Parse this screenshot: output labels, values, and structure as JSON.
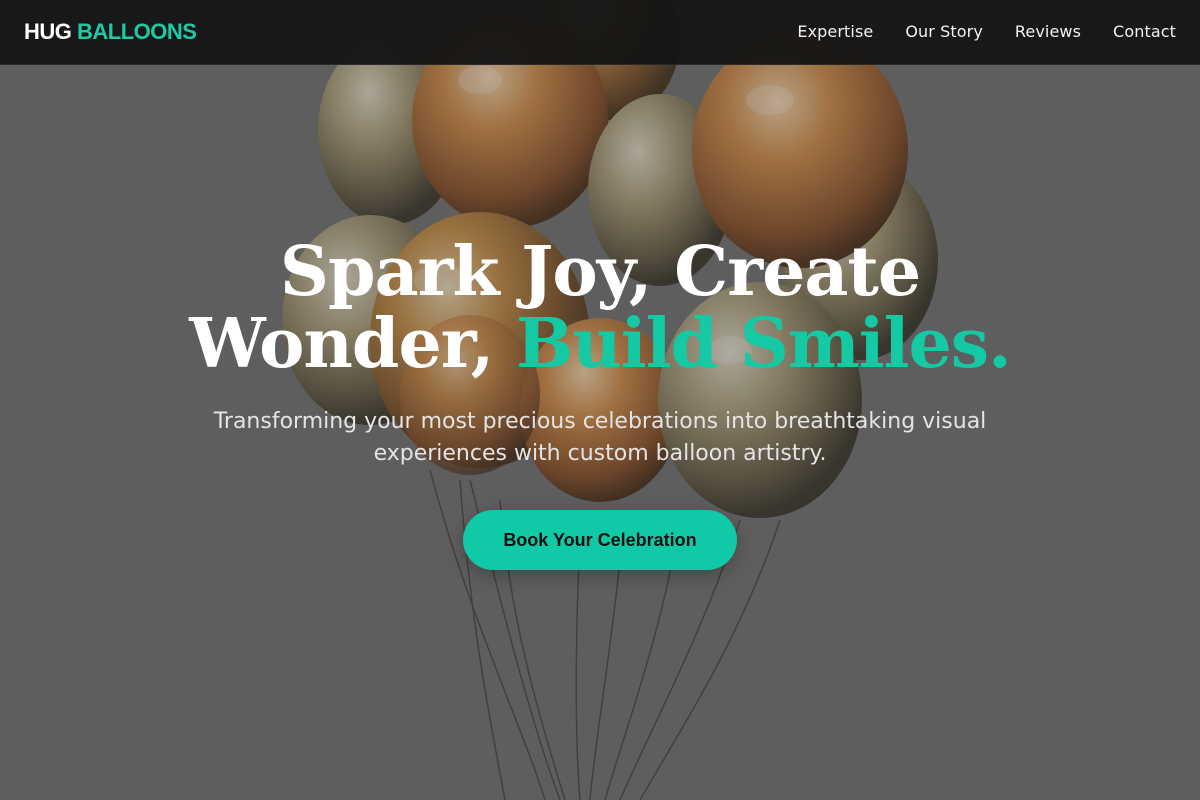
{
  "brand": {
    "name_part1": "HUG",
    "name_part2": "BALLOONS"
  },
  "nav": {
    "links": [
      {
        "label": "Expertise"
      },
      {
        "label": "Our Story"
      },
      {
        "label": "Reviews"
      },
      {
        "label": "Contact"
      }
    ]
  },
  "hero": {
    "headline_line1": "Spark Joy, Create",
    "headline_line2_start": "Wonder, ",
    "headline_line2_highlight": "Build Smiles.",
    "subtitle": "Transforming your most precious celebrations into breathtaking visual experiences with custom balloon artistry.",
    "cta_label": "Book Your Celebration",
    "background": "balloon-bouquet-image"
  },
  "colors": {
    "accent": "#15c9a4",
    "nav_bg": "#141414",
    "cta_bg": "#10c9a6",
    "cta_text": "#111111"
  }
}
